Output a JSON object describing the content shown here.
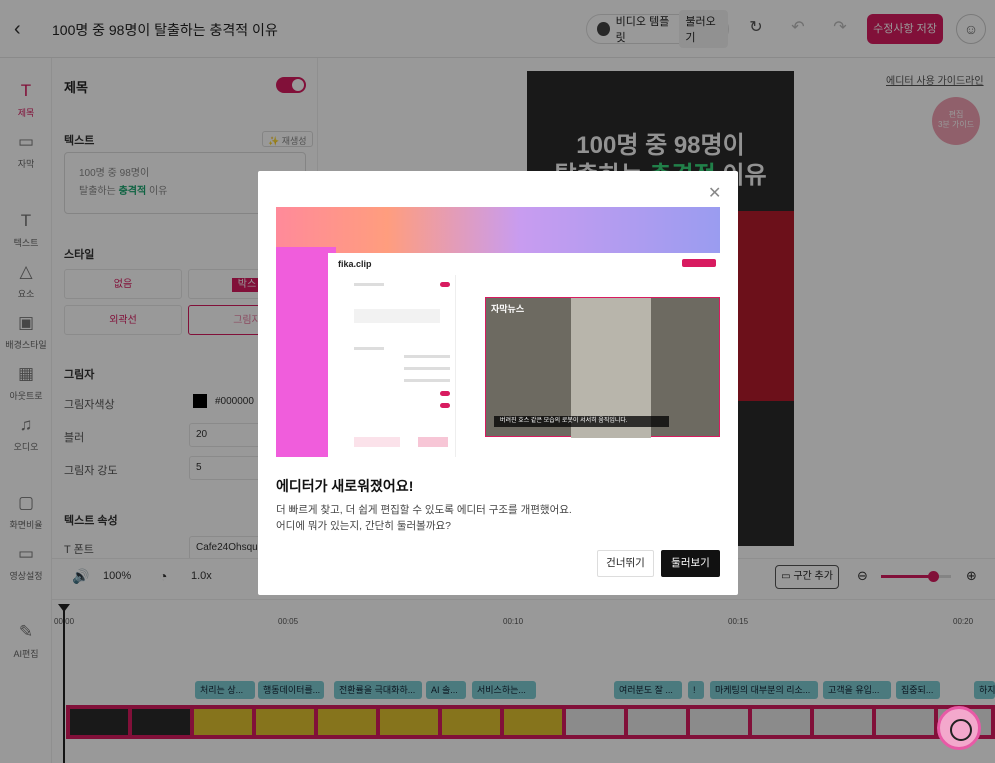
{
  "header": {
    "title": "100명 중 98명이 탈출하는 충격적 이유",
    "template_label": "비디오 템플릿",
    "import_label": "불러오기",
    "save_label": "수정사항 저장"
  },
  "rail": {
    "items": [
      {
        "label": "제목",
        "icon": "T"
      },
      {
        "label": "자막",
        "icon": "▭"
      },
      {
        "label": "텍스트",
        "icon": "T"
      },
      {
        "label": "요소",
        "icon": "△"
      },
      {
        "label": "배경스타일",
        "icon": "▣"
      },
      {
        "label": "아웃트로",
        "icon": "▦"
      },
      {
        "label": "오디오",
        "icon": "♫"
      },
      {
        "label": "화면비율",
        "icon": "▢"
      },
      {
        "label": "영상설정",
        "icon": "▭"
      },
      {
        "label": "AI편집",
        "icon": "✎"
      }
    ]
  },
  "panel": {
    "title": "제목",
    "text_label": "텍스트",
    "regen_label": "재생성",
    "text_line1": "100명 중 98명이",
    "text_line2_pre": "탈출하는 ",
    "text_line2_hl": "충격적",
    "text_line2_post": " 이유",
    "style_label": "스타일",
    "style_none": "없음",
    "style_box": "박스",
    "style_outline": "외곽선",
    "style_shadow": "그림자",
    "shadow_label": "그림자",
    "shadow_color_label": "그림자색상",
    "shadow_color_value": "#000000",
    "blur_label": "블러",
    "blur_value": "20",
    "strength_label": "그림자 강도",
    "strength_value": "5",
    "text_props_label": "텍스트 속성",
    "font_label": "폰트",
    "font_value": "Cafe24Ohsquare"
  },
  "preview": {
    "title_line1": "100명 중 98명이",
    "title_line2_pre": "탈출하는 ",
    "title_line2_hl": "충격적",
    "title_line2_post": " 이유"
  },
  "guide": {
    "link": "에디터 사용 가이드라인",
    "fab_line1": "편집",
    "fab_line2": "3분 가이드"
  },
  "playbar": {
    "speed_pct": "100%",
    "rate": "1.0x",
    "segment_add": "구간 추가"
  },
  "timeline": {
    "ticks": [
      "00:00",
      "00:05",
      "00:10",
      "00:15",
      "00:20"
    ],
    "chips": [
      "처리는 상...",
      "행동데이터를...",
      "전환률을 극대화하...",
      "AI 솔...",
      "서비스하는...",
      "여러분도 잘 ...",
      "!",
      "마케팅의 대부분의 리소...",
      "고객을 유입...",
      "집중되...",
      "하지"
    ]
  },
  "modal": {
    "heading": "에디터가 새로워졌어요!",
    "body_line1": "더 빠르게 찾고, 더 쉽게 편집할 수 있도록 에디터 구조를 개편했어요.",
    "body_line2": "어디에 뭐가 있는지, 간단히 둘러볼까요?",
    "skip_label": "건너뛰기",
    "tour_label": "둘러보기",
    "mock_logo": "fika.clip",
    "mock_badge": "자막뉴스",
    "mock_caption": "버려진 호스 같은 모습의 로봇이 서서히 움직입니다."
  },
  "colors": {
    "accent": "#d81b60",
    "highlight_green": "#37d67a"
  }
}
